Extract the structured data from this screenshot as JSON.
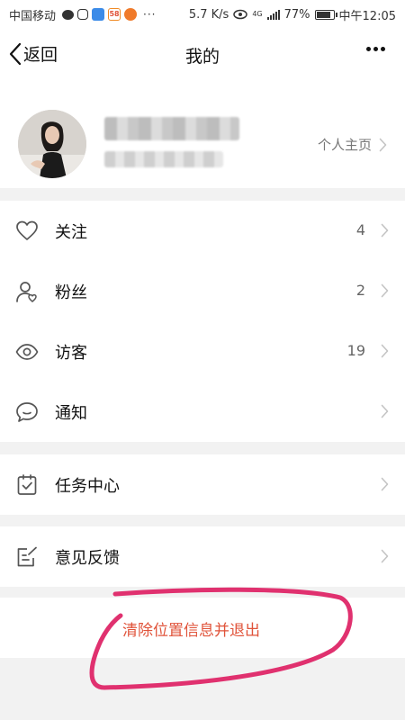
{
  "status_bar": {
    "carrier": "中国移动",
    "network_speed": "5.7 K/s",
    "network_type": "4G",
    "battery_percent": "77%",
    "battery_level": 0.77,
    "time": "中午12:05",
    "app_badge": "58"
  },
  "nav": {
    "back_label": "返回",
    "title": "我的"
  },
  "profile": {
    "homepage_label": "个人主页"
  },
  "menu": {
    "follow": {
      "label": "关注",
      "count": "4"
    },
    "fans": {
      "label": "粉丝",
      "count": "2"
    },
    "visitors": {
      "label": "访客",
      "count": "19"
    },
    "notifications": {
      "label": "通知"
    },
    "task_center": {
      "label": "任务中心"
    },
    "feedback": {
      "label": "意见反馈"
    }
  },
  "logout": {
    "label": "清除位置信息并退出"
  },
  "colors": {
    "accent_red": "#e0533a",
    "annotation_pink": "#e0316f",
    "divider": "#f2f2f2",
    "icon_gray": "#555555"
  }
}
